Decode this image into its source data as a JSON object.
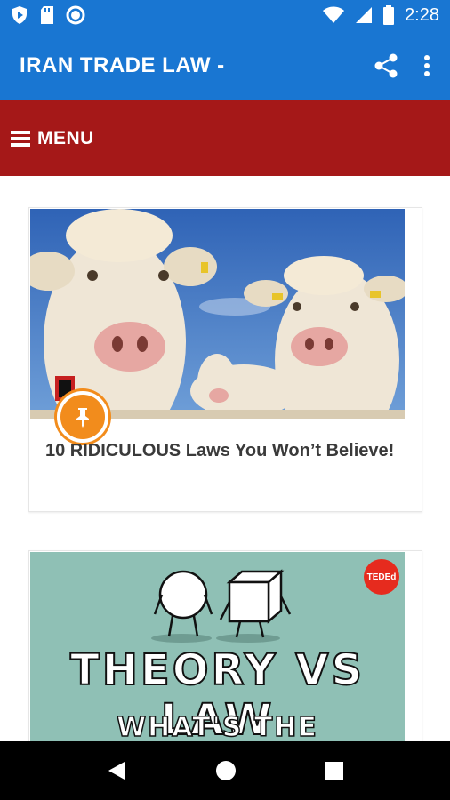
{
  "status_bar": {
    "time": "2:28",
    "icons": [
      "play-protect-icon",
      "sd-card-icon",
      "sync-icon",
      "wifi-icon",
      "signal-icon",
      "battery-icon"
    ]
  },
  "app_bar": {
    "title": "IRAN TRADE LAW -",
    "actions": [
      "share-icon",
      "more-vert-icon"
    ]
  },
  "menu": {
    "label": "MENU"
  },
  "posts": [
    {
      "title": "10 RIDICULOUS Laws You Won’t Believe!",
      "badge": "pin-icon"
    },
    {
      "title": "THEORY VS LAW",
      "subtitle": "WHAT'S THE DIFFERENCE?",
      "badge_text": "TEDEd"
    }
  ],
  "nav_bar": {
    "buttons": [
      "back-icon",
      "home-icon",
      "recents-icon"
    ]
  },
  "colors": {
    "app_bar": "#1976d2",
    "menu_bar": "#a51818",
    "pin": "#f28c1c"
  }
}
